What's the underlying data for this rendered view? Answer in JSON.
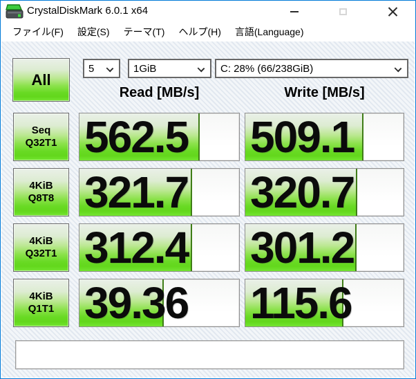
{
  "window": {
    "title": "CrystalDiskMark 6.0.1 x64"
  },
  "menu": {
    "items": [
      {
        "label": "ファイル(F)"
      },
      {
        "label": "設定(S)"
      },
      {
        "label": "テーマ(T)"
      },
      {
        "label": "ヘルプ(H)"
      },
      {
        "label": "言語(Language)"
      }
    ]
  },
  "toolbar": {
    "all_label": "All",
    "test_count": "5",
    "test_size": "1GiB",
    "target_drive": "C: 28% (66/238GiB)"
  },
  "columns": {
    "read": "Read [MB/s]",
    "write": "Write [MB/s]"
  },
  "rows": [
    {
      "label1": "Seq",
      "label2": "Q32T1",
      "read": "562.5",
      "write": "509.1"
    },
    {
      "label1": "4KiB",
      "label2": "Q8T8",
      "read": "321.7",
      "write": "320.7"
    },
    {
      "label1": "4KiB",
      "label2": "Q32T1",
      "read": "312.4",
      "write": "301.2"
    },
    {
      "label1": "4KiB",
      "label2": "Q1T1",
      "read": "39.36",
      "write": "115.6"
    }
  ],
  "footer": {
    "comment_value": ""
  },
  "chart_data": {
    "type": "bar",
    "categories": [
      "Seq Q32T1",
      "4KiB Q8T8",
      "4KiB Q32T1",
      "4KiB Q1T1"
    ],
    "series": [
      {
        "name": "Read [MB/s]",
        "values": [
          562.5,
          321.7,
          312.4,
          39.36
        ]
      },
      {
        "name": "Write [MB/s]",
        "values": [
          509.1,
          320.7,
          301.2,
          115.6
        ]
      }
    ],
    "unit": "MB/s",
    "scale": "logarithmic",
    "legend_position": "column-headers",
    "bar_color": "#63d71c"
  },
  "colors": {
    "accent_green": "#63d71c",
    "bar_edge_green": "#3f7d17",
    "window_border_blue": "#0079d8",
    "text": "#000000"
  }
}
